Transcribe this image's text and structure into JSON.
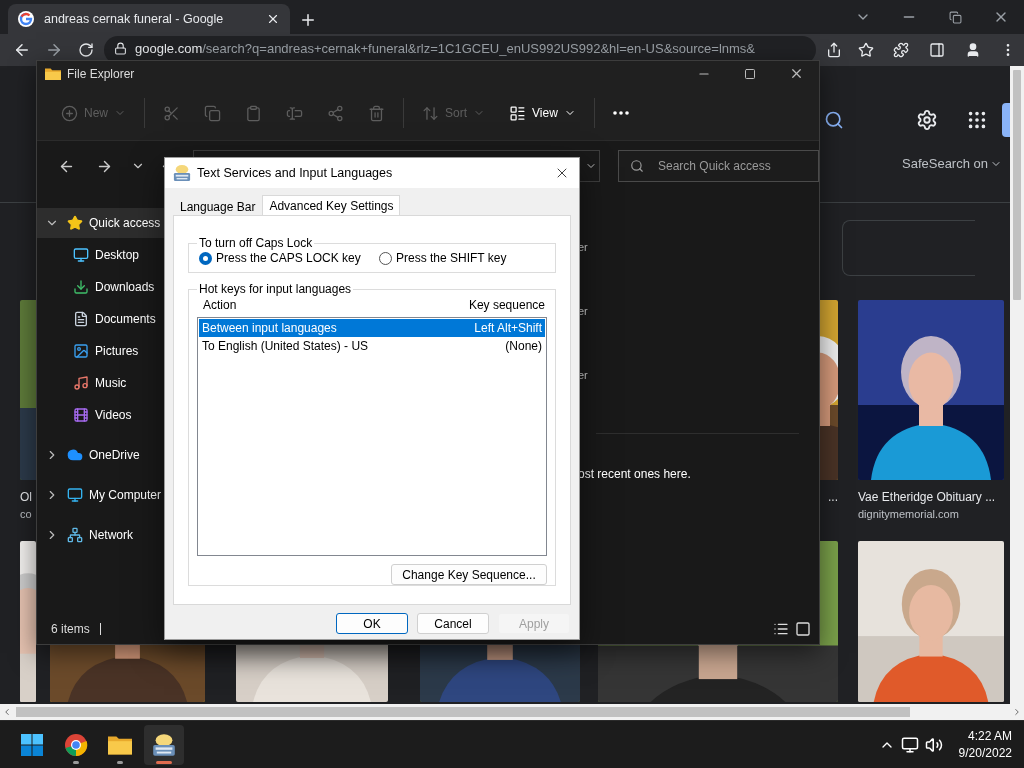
{
  "browser": {
    "tab_title": "andreas cernak funeral - Google",
    "url_host": "google.com",
    "url_path": "/search?q=andreas+cernak+funeral&rlz=1C1GCEU_enUS992US992&hl=en-US&source=lnms&",
    "safesearch": "SafeSearch on",
    "results": [
      {
        "caption": "Ol",
        "source": "co"
      },
      {
        "caption": "..."
      },
      {
        "caption": "Vae Etheridge Obituary ...",
        "source": "dignitymemorial.com"
      }
    ]
  },
  "explorer": {
    "title": "File Explorer",
    "toolbar": [
      {
        "kind": "new",
        "label": "New",
        "disabled": true
      },
      {
        "kind": "cut",
        "disabled": true
      },
      {
        "kind": "copy",
        "disabled": true
      },
      {
        "kind": "paste",
        "disabled": true
      },
      {
        "kind": "rename",
        "disabled": true
      },
      {
        "kind": "share",
        "disabled": true
      },
      {
        "kind": "delete",
        "disabled": true
      },
      {
        "kind": "sort",
        "label": "Sort",
        "disabled": true
      },
      {
        "kind": "view",
        "label": "View",
        "disabled": false
      },
      {
        "kind": "more",
        "disabled": false
      }
    ],
    "search": {
      "placeholder": "Search Quick access"
    },
    "sidebar": {
      "items": [
        {
          "kind": "star",
          "label": "Quick access",
          "selected": true,
          "expanded": true,
          "children": [
            {
              "kind": "desktop",
              "label": "Desktop",
              "selected": false
            },
            {
              "kind": "downloads",
              "label": "Downloads",
              "selected": false
            },
            {
              "kind": "documents",
              "label": "Documents",
              "selected": false
            },
            {
              "kind": "pictures",
              "label": "Pictures",
              "selected": false
            },
            {
              "kind": "music",
              "label": "Music",
              "selected": false
            },
            {
              "kind": "videos",
              "label": "Videos",
              "selected": false
            }
          ]
        },
        {
          "kind": "cloud",
          "label": "OneDrive",
          "selected": false,
          "expanded": false
        },
        {
          "kind": "computer",
          "label": "My Computer",
          "selected": false,
          "expanded": false
        },
        {
          "kind": "network",
          "label": "Network",
          "selected": false,
          "expanded": false
        }
      ]
    },
    "content_fragments": [
      "er",
      "er",
      "er"
    ],
    "note": "ost recent ones here.",
    "status": "6 items"
  },
  "dialog": {
    "title": "Text Services and Input Languages",
    "tabs": [
      {
        "label": "Language Bar",
        "selected": false
      },
      {
        "label": "Advanced Key Settings",
        "selected": true
      }
    ],
    "caps_lock": {
      "label": "To turn off Caps Lock",
      "options": [
        {
          "label": "Press the CAPS LOCK key",
          "selected": true
        },
        {
          "label": "Press the SHIFT key",
          "selected": false
        }
      ]
    },
    "hotkeys": {
      "label": "Hot keys for input languages",
      "columns": [
        "Action",
        "Key sequence"
      ],
      "rows": [
        {
          "action": "Between input languages",
          "keys": "Left Alt+Shift",
          "selected": true
        },
        {
          "action": "To English (United States) - US",
          "keys": "(None)",
          "selected": false
        }
      ]
    },
    "change_button": "Change Key Sequence...",
    "buttons": [
      {
        "label": "OK",
        "kind": "default",
        "disabled": false
      },
      {
        "label": "Cancel",
        "kind": "normal",
        "disabled": false
      },
      {
        "label": "Apply",
        "kind": "normal",
        "disabled": true
      }
    ]
  },
  "taskbar": {
    "apps": [
      {
        "kind": "start",
        "selected": false,
        "running": false
      },
      {
        "kind": "chrome",
        "selected": false,
        "running": true
      },
      {
        "kind": "explorer",
        "selected": false,
        "running": true
      },
      {
        "kind": "keyboard",
        "selected": true,
        "running": true
      }
    ],
    "time": "4:22 AM",
    "date": "9/20/2022"
  }
}
